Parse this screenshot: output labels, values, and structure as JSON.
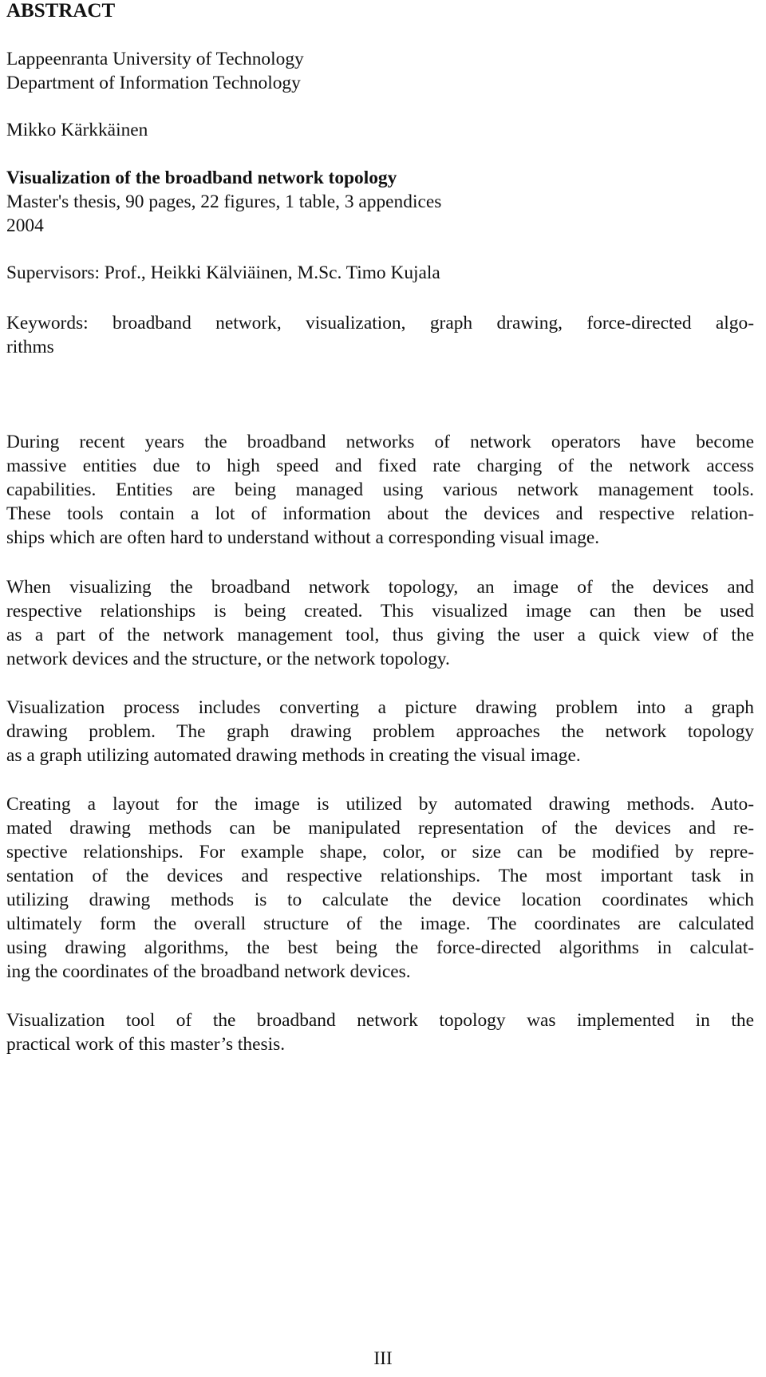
{
  "heading": "ABSTRACT",
  "affiliation": {
    "university": "Lappeenranta University of Technology",
    "department": "Department of Information Technology"
  },
  "author": "Mikko Kärkkäinen",
  "thesis": {
    "title": "Visualization of the broadband network topology",
    "details": "Master's thesis, 90 pages, 22 figures, 1 table, 3 appendices",
    "year": "2004"
  },
  "supervisors": "Supervisors: Prof., Heikki Kälviäinen, M.Sc. Timo Kujala",
  "keywords": {
    "lines": [
      "Keywords: broadband network, visualization, graph drawing, force-directed algo-",
      "rithms"
    ]
  },
  "paragraphs": [
    {
      "lines": [
        "During recent years the broadband networks of network operators have become",
        "massive entities due to high speed and fixed rate charging of the network access",
        "capabilities. Entities are being managed using various network management tools.",
        "These tools contain a lot of information about the devices and respective relation-",
        "ships which are often hard to understand without a corresponding visual image."
      ]
    },
    {
      "lines": [
        "When visualizing the broadband network topology, an image of the devices and",
        "respective relationships is being created. This visualized image can then be used",
        "as a part of the network management tool, thus giving the user a quick view of the",
        "network devices and the structure, or the network topology."
      ]
    },
    {
      "lines": [
        "Visualization process includes converting a picture drawing problem into a graph",
        "drawing problem. The graph drawing problem approaches the network topology",
        "as a graph utilizing automated drawing methods in creating the visual image."
      ]
    },
    {
      "lines": [
        "Creating a layout for the image is utilized by automated drawing methods. Auto-",
        "mated drawing methods can be manipulated representation of the devices and re-",
        "spective relationships. For example shape, color, or size can be modified by repre-",
        "sentation of the devices and respective relationships. The most important task in",
        "utilizing drawing methods is to calculate the device location coordinates which",
        "ultimately form the overall structure of the image. The coordinates are calculated",
        "using drawing algorithms, the best being the force-directed algorithms in calculat-",
        "ing the coordinates of the broadband network devices."
      ]
    },
    {
      "lines": [
        "Visualization tool of the broadband network topology was implemented in the",
        "practical work of this master’s thesis."
      ]
    }
  ],
  "page_number": "III"
}
